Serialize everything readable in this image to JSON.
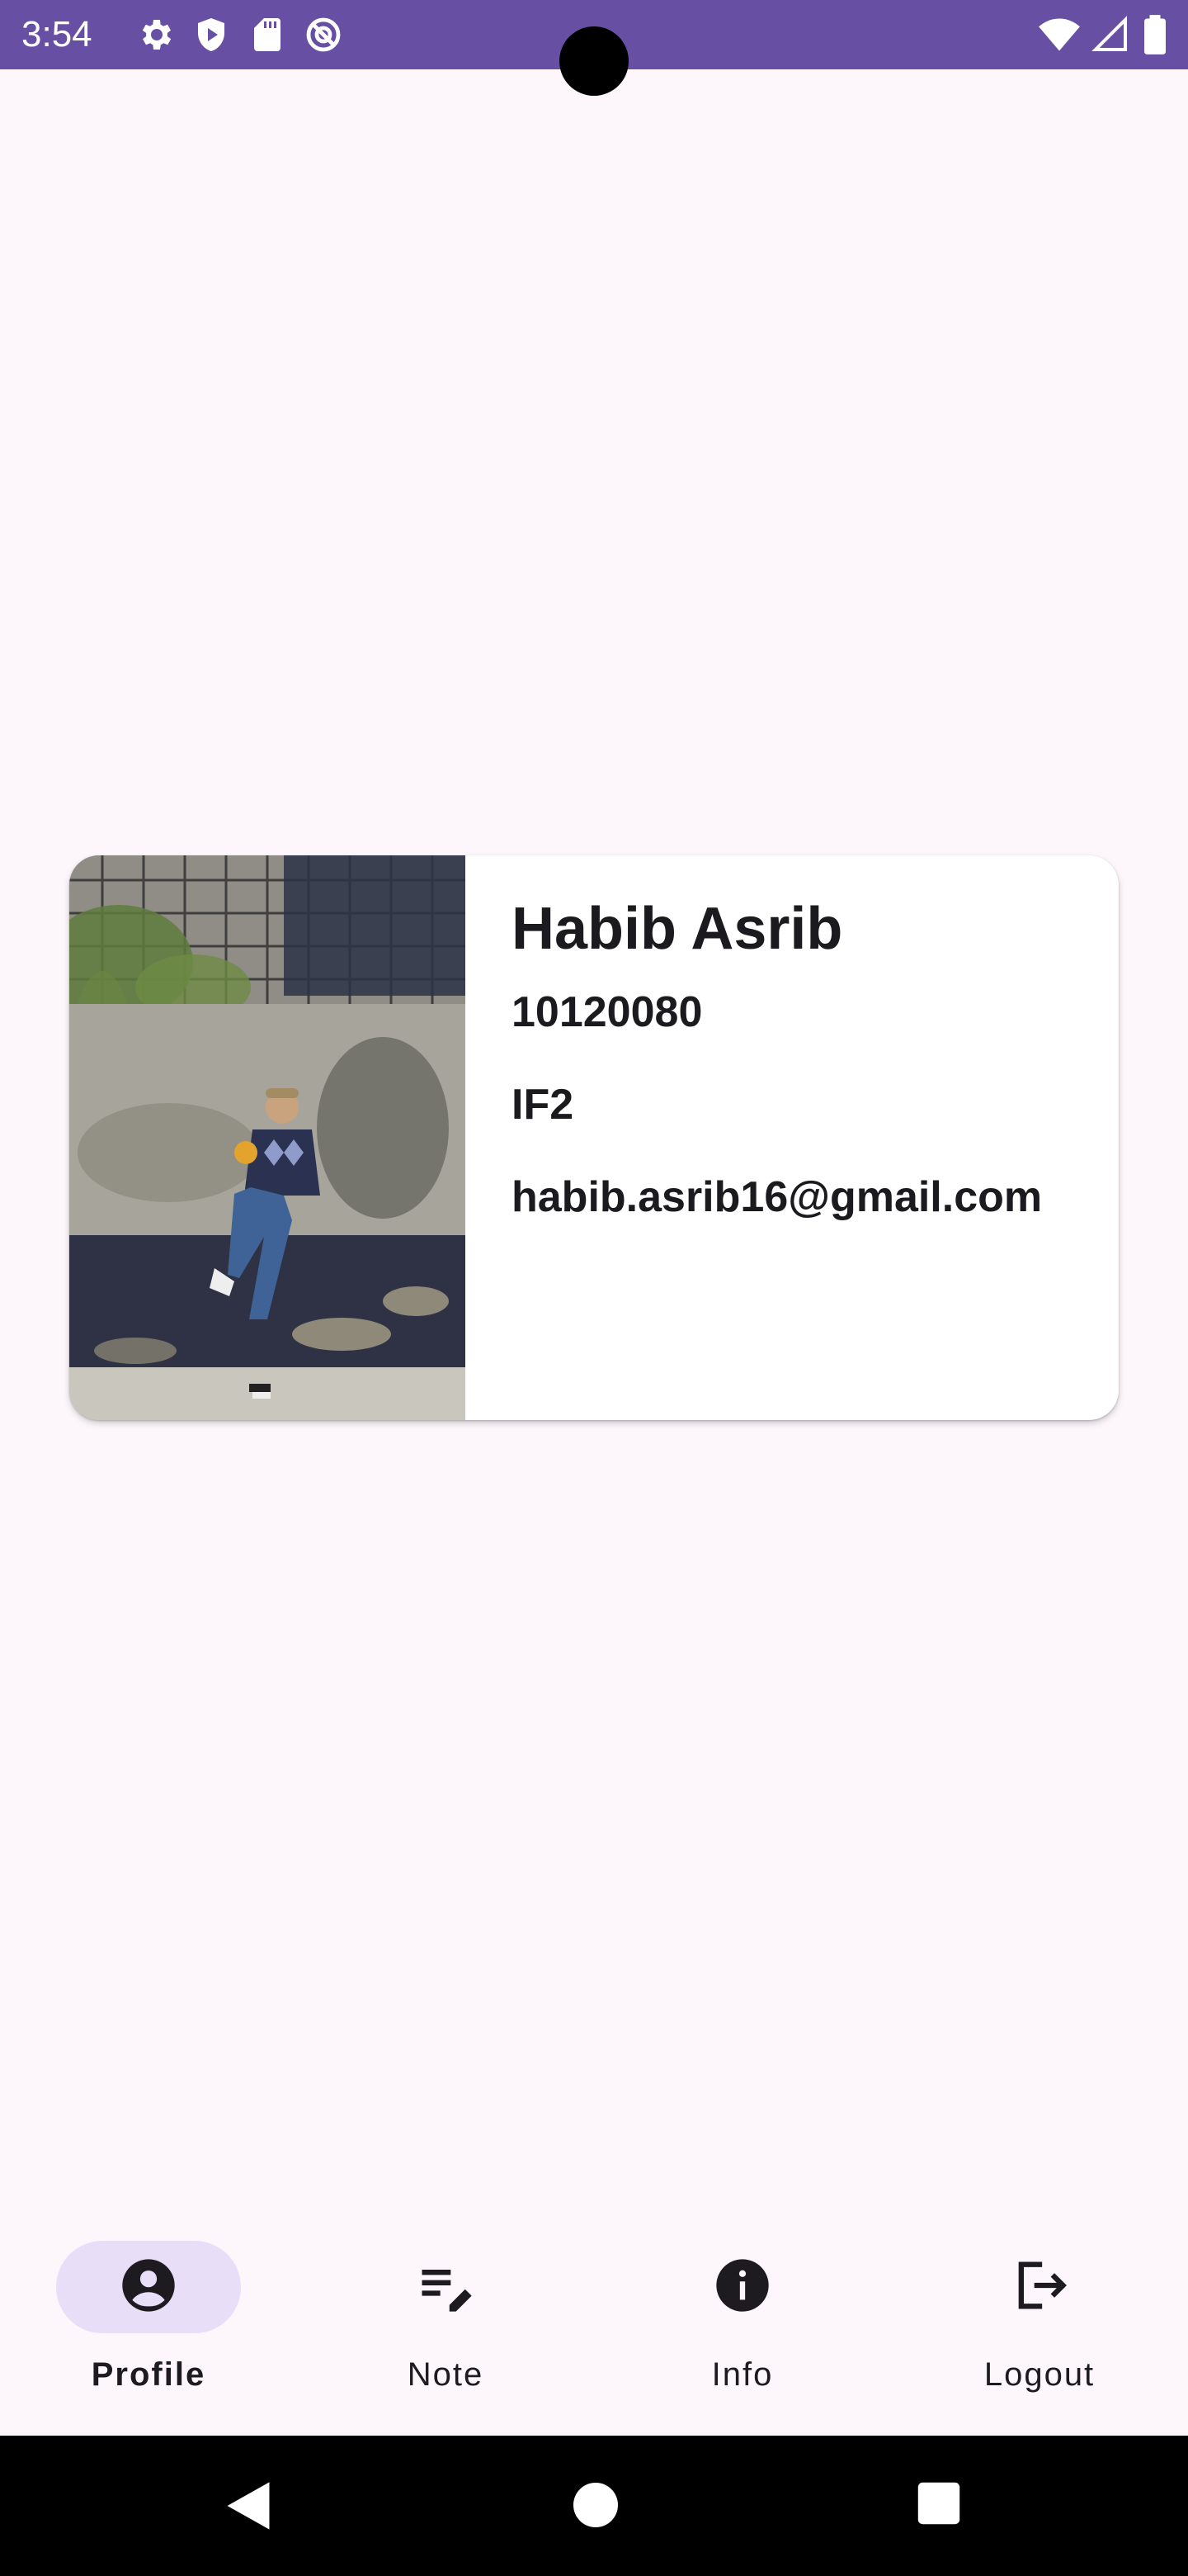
{
  "status_bar": {
    "time": "3:54",
    "background": "#6750a4",
    "left_icons": [
      "settings-icon",
      "shield-icon",
      "sd-card-icon",
      "no-disturb-icon"
    ],
    "right_icons": [
      "wifi-icon",
      "cell-signal-icon",
      "battery-icon"
    ]
  },
  "profile": {
    "photo": "profile-photo",
    "name": "Habib Asrib",
    "student_id": "10120080",
    "class": "IF2",
    "email": "habib.asrib16@gmail.com"
  },
  "bottom_nav": {
    "active_color": "#e8def8",
    "items": [
      {
        "label": "Profile",
        "icon": "account-circle-icon",
        "active": true
      },
      {
        "label": "Note",
        "icon": "edit-note-icon",
        "active": false
      },
      {
        "label": "Info",
        "icon": "info-icon",
        "active": false
      },
      {
        "label": "Logout",
        "icon": "logout-icon",
        "active": false
      }
    ]
  },
  "system_nav": {
    "buttons": [
      "back-icon",
      "home-icon",
      "recents-icon"
    ]
  }
}
